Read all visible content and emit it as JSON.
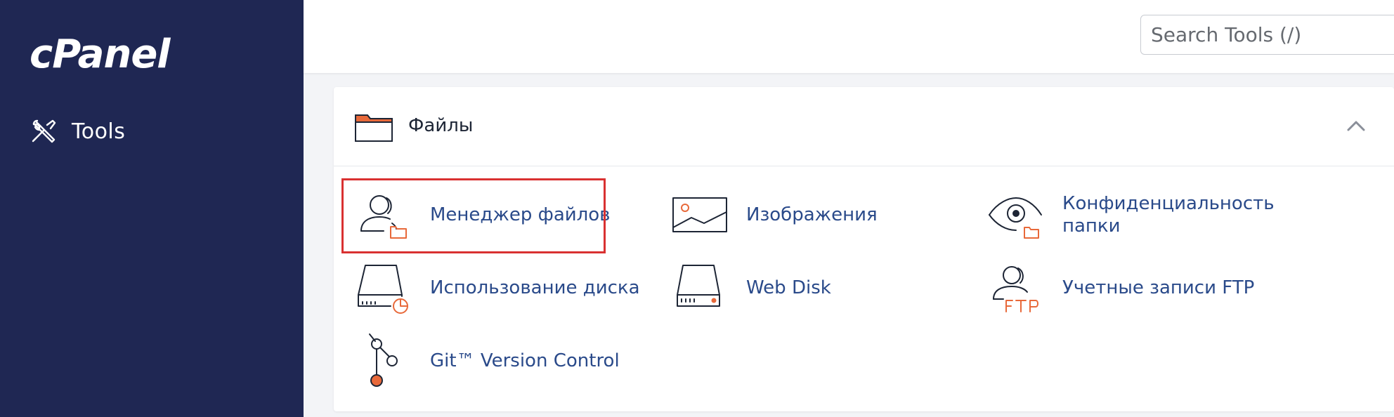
{
  "sidebar": {
    "logo": "cPanel",
    "nav": [
      {
        "label": "Tools",
        "icon": "tools-icon"
      }
    ]
  },
  "search": {
    "placeholder": "Search Tools (/)",
    "value": ""
  },
  "section": {
    "title": "Файлы",
    "icon": "folder-icon",
    "collapse_icon": "chevron-up-icon",
    "tools": [
      {
        "label": "Менеджер файлов",
        "icon": "file-manager-icon",
        "highlighted": true
      },
      {
        "label": "Изображения",
        "icon": "images-icon"
      },
      {
        "label_lines": [
          "Конфиденциальность",
          "папки"
        ],
        "icon": "directory-privacy-icon"
      },
      {
        "label": "Использование диска",
        "icon": "disk-usage-icon"
      },
      {
        "label": "Web Disk",
        "icon": "web-disk-icon"
      },
      {
        "label": "Учетные записи FTP",
        "icon": "ftp-accounts-icon"
      },
      {
        "label": "Git™ Version Control",
        "icon": "git-version-control-icon"
      }
    ]
  },
  "colors": {
    "sidebar_bg": "#1f2753",
    "accent_orange": "#e8693a",
    "link_blue": "#2a4a8a",
    "highlight_red": "#d93131"
  }
}
